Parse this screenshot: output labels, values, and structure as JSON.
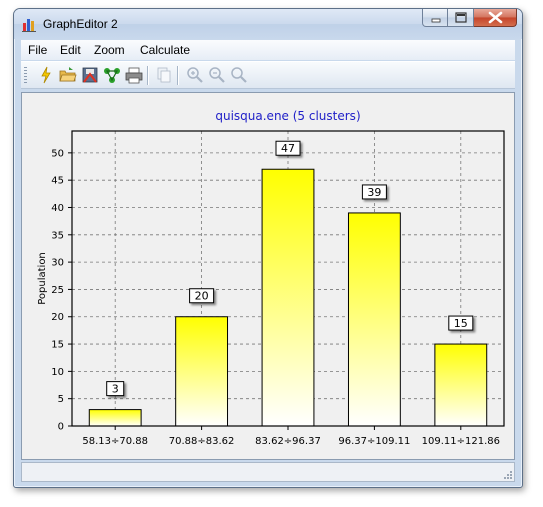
{
  "window": {
    "title": "GraphEditor 2"
  },
  "menu": {
    "items": [
      "File",
      "Edit",
      "Zoom",
      "Calculate"
    ]
  },
  "toolbar": {
    "buttons": [
      "lightning-icon",
      "open-folder-icon",
      "save-icon",
      "graph-icon",
      "print-icon",
      "copy-icon",
      "zoom-in-icon",
      "zoom-out-icon",
      "zoom-reset-icon"
    ]
  },
  "colors": {
    "bar_top": "#ffff00",
    "bar_bottom": "#ffffff",
    "title": "#2020c8",
    "grid": "#777777"
  },
  "chart_data": {
    "type": "bar",
    "title": "quisqua.ene (5 clusters)",
    "xlabel": "",
    "ylabel": "Population",
    "categories": [
      "58.13÷70.88",
      "70.88÷83.62",
      "83.62÷96.37",
      "96.37÷109.11",
      "109.11÷121.86"
    ],
    "values": [
      3,
      20,
      47,
      39,
      15
    ],
    "ylim": [
      0,
      54
    ],
    "yticks": [
      0,
      5,
      10,
      15,
      20,
      25,
      30,
      35,
      40,
      45,
      50
    ],
    "grid": true,
    "data_labels": true
  }
}
